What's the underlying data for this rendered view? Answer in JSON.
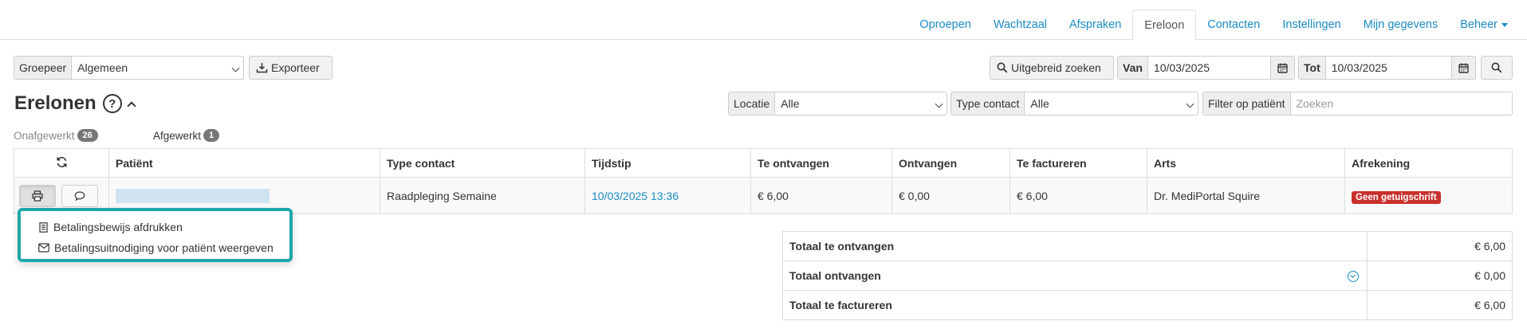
{
  "nav": {
    "tabs": [
      {
        "label": "Oproepen"
      },
      {
        "label": "Wachtzaal"
      },
      {
        "label": "Afspraken"
      },
      {
        "label": "Ereloon",
        "active": true
      },
      {
        "label": "Contacten"
      },
      {
        "label": "Instellingen"
      },
      {
        "label": "Mijn gegevens"
      },
      {
        "label": "Beheer",
        "dropdown": true
      }
    ]
  },
  "toolbar": {
    "group_label": "Groepeer",
    "group_value": "Algemeen",
    "export_label": "Exporteer",
    "advanced_search_label": "Uitgebreid zoeken",
    "from_label": "Van",
    "from_value": "10/03/2025",
    "to_label": "Tot",
    "to_value": "10/03/2025"
  },
  "page": {
    "title": "Erelonen"
  },
  "filters": {
    "location_label": "Locatie",
    "location_value": "Alle",
    "contact_type_label": "Type contact",
    "contact_type_value": "Alle",
    "patient_filter_label": "Filter op patiënt",
    "patient_filter_placeholder": "Zoeken"
  },
  "status_tabs": [
    {
      "label": "Onafgewerkt",
      "count": "26"
    },
    {
      "label": "Afgewerkt",
      "count": "1"
    }
  ],
  "table": {
    "headers": [
      "Patiënt",
      "Type contact",
      "Tijdstip",
      "Te ontvangen",
      "Ontvangen",
      "Te factureren",
      "Arts",
      "Afrekening"
    ],
    "rows": [
      {
        "patient": "",
        "type_contact": "Raadpleging Semaine",
        "tijdstip": "10/03/2025 13:36",
        "te_ontvangen": "€ 6,00",
        "ontvangen": "€ 0,00",
        "te_factureren": "€ 6,00",
        "arts": "Dr. MediPortal Squire",
        "afrekening": "Geen getuigschrift"
      }
    ]
  },
  "menu": {
    "items": [
      {
        "label": "Betalingsbewijs afdrukken",
        "icon": "receipt-icon"
      },
      {
        "label": "Betalingsuitnodiging voor patiënt weergeven",
        "icon": "envelope-icon"
      }
    ]
  },
  "totals": {
    "rows": [
      {
        "label": "Totaal te ontvangen",
        "value": "€ 6,00"
      },
      {
        "label": "Totaal ontvangen",
        "value": "€ 0,00"
      },
      {
        "label": "Totaal te factureren",
        "value": "€ 6,00"
      }
    ]
  },
  "colors": {
    "link": "#1a8bc4",
    "danger": "#c9302c",
    "menu_highlight": "#1fa7a7",
    "badge": "#777777"
  }
}
